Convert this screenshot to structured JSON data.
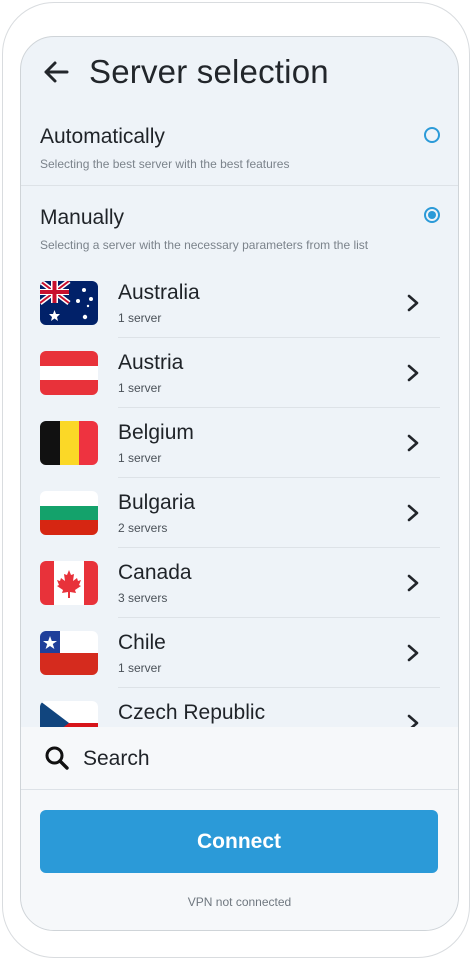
{
  "header": {
    "title": "Server selection",
    "back_icon": "arrow-left-icon"
  },
  "options": {
    "automatic": {
      "label": "Automatically",
      "description": "Selecting the best server with the best features",
      "selected": false
    },
    "manual": {
      "label": "Manually",
      "description": "Selecting a server with the necessary parameters from the list",
      "selected": true
    }
  },
  "countries": [
    {
      "name": "Australia",
      "servers": "1 server",
      "flag": "australia-flag-icon"
    },
    {
      "name": "Austria",
      "servers": "1 server",
      "flag": "austria-flag-icon"
    },
    {
      "name": "Belgium",
      "servers": "1 server",
      "flag": "belgium-flag-icon"
    },
    {
      "name": "Bulgaria",
      "servers": "2 servers",
      "flag": "bulgaria-flag-icon"
    },
    {
      "name": "Canada",
      "servers": "3 servers",
      "flag": "canada-flag-icon"
    },
    {
      "name": "Chile",
      "servers": "1 server",
      "flag": "chile-flag-icon"
    },
    {
      "name": "Czech Republic",
      "servers": "",
      "flag": "czech-flag-icon"
    }
  ],
  "search": {
    "label": "Search",
    "icon": "search-icon"
  },
  "connect": {
    "label": "Connect"
  },
  "status": {
    "text": "VPN not connected"
  },
  "colors": {
    "accent": "#2b9ad8",
    "background": "#eef3f8",
    "text": "#1f2328"
  }
}
